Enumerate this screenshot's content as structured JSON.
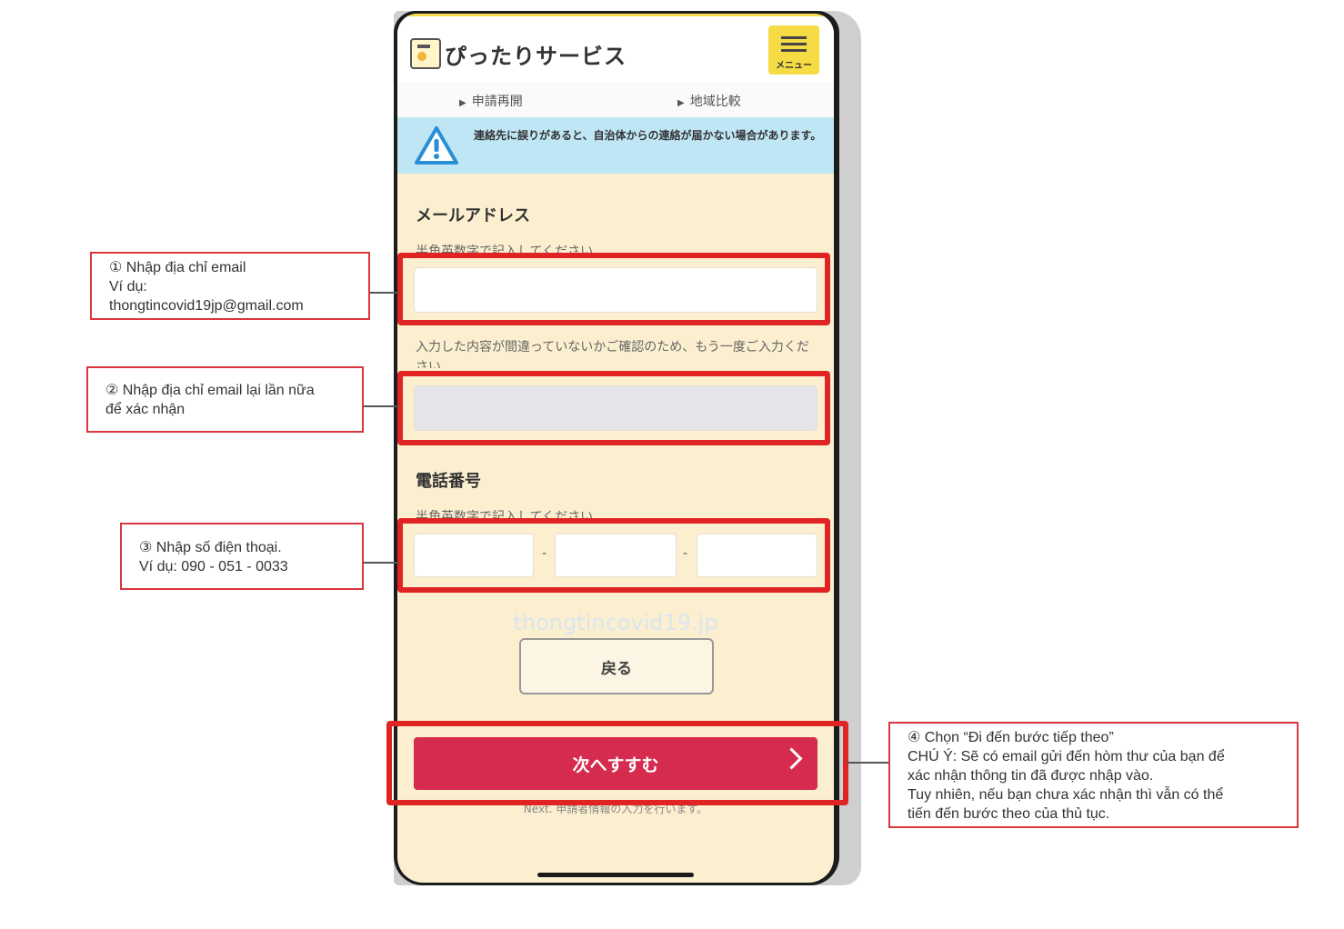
{
  "app": {
    "brand": "ぴったりサービス",
    "menu_label": "メニュー"
  },
  "subnav": {
    "resume": "申請再開",
    "compare": "地域比較"
  },
  "notice": {
    "text": "連絡先に誤りがあると、自治体からの連絡が届かない場合があります。"
  },
  "form": {
    "email_label": "メールアドレス",
    "email_hint": "半角英数字で記入してください",
    "email_value": "",
    "confirm_hint": "入力した内容が間違っていないかご確認のため、もう一度ご入力ください",
    "confirm_value": "",
    "phone_label": "電話番号",
    "phone_hint": "半角英数字で記入してください",
    "phone_part1": "",
    "phone_part2": "",
    "phone_part3": "",
    "phone_separator": "-"
  },
  "watermark": "thongtincovid19.jp",
  "buttons": {
    "back": "戻る",
    "next": "次へすすむ",
    "next_note": "Next. 申請者情報の入力を行います。"
  },
  "callouts": {
    "c1": [
      "① Nhập địa chỉ email",
      "Ví dụ:",
      "thongtincovid19jp@gmail.com"
    ],
    "c2": [
      "② Nhập địa chỉ email lại lần nữa",
      "để xác nhận"
    ],
    "c3": [
      "③ Nhập số điện thoại.",
      "Ví dụ: 090 - 051 - 0033"
    ],
    "c4": [
      "④ Chọn “Đi đến bước tiếp theo”",
      "CHÚ Ý: Sẽ có email gửi đến hòm thư của bạn để",
      "xác nhận thông tin đã được nhập vào.",
      "Tuy nhiên, nếu bạn chưa xác nhận thì vẫn có thể",
      "tiến đến bước theo của thủ tục."
    ]
  },
  "colors": {
    "highlight": "#e02323",
    "primary_button": "#d42b4f",
    "menu_button": "#f5dc45",
    "notice_bg": "#bfe6f5",
    "form_bg": "#fcefd0"
  }
}
